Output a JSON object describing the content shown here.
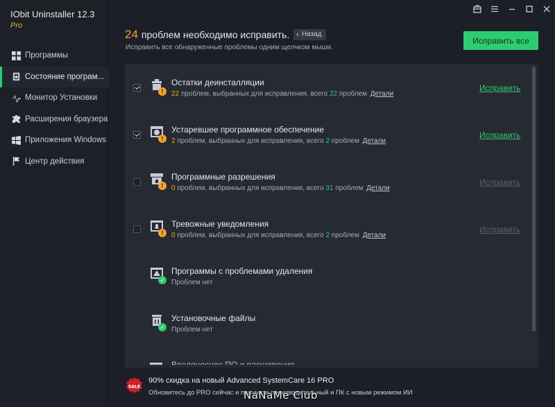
{
  "app": {
    "title": "IObit Uninstaller 12.3",
    "edition": "Pro"
  },
  "sidebar": {
    "items": [
      {
        "label": "Программы",
        "icon": "grid-icon",
        "active": false
      },
      {
        "label": "Состояние програм...",
        "icon": "health-icon",
        "active": true
      },
      {
        "label": "Монитор Установки",
        "icon": "monitor-icon",
        "active": false
      },
      {
        "label": "Расширения браузера",
        "icon": "puzzle-icon",
        "active": false
      },
      {
        "label": "Приложения Windows",
        "icon": "windows-icon",
        "active": false
      },
      {
        "label": "Центр действия",
        "icon": "flag-icon",
        "active": false
      }
    ]
  },
  "window_controls": [
    "toolbox-icon",
    "menu-icon",
    "minimize-icon",
    "maximize-icon",
    "close-icon"
  ],
  "header": {
    "count": "24",
    "title": "проблем необходимо исправить.",
    "back_label": "Назад",
    "subtitle": "Исправить все обнаруженные проблемы одним щелчком мыши.",
    "fix_all_label": "Исправить все"
  },
  "colors": {
    "accent": "#2ecc71",
    "warning": "#f0a52c",
    "background": "#1c1f27",
    "panel": "#262a33"
  },
  "issues": [
    {
      "title": "Остатки деинсталляции",
      "selected": "22",
      "stats_mid": "проблем, выбранных для исправления, всего",
      "total": "22",
      "stats_end": "проблем",
      "details": "Детали",
      "fix": "Исправить",
      "checked": true,
      "status": "warning",
      "icon": "eraser-icon"
    },
    {
      "title": "Устаревшее программное обеспечение",
      "selected": "2",
      "stats_mid": "проблем, выбранных для исправления, всего",
      "total": "2",
      "stats_end": "проблем",
      "details": "Детали",
      "fix": "Исправить",
      "checked": true,
      "status": "warning",
      "icon": "outdated-software-icon"
    },
    {
      "title": "Программные разрешения",
      "selected": "0",
      "stats_mid": "проблем, выбранных для исправления, всего",
      "total": "31",
      "stats_end": "проблем",
      "details": "Детали",
      "fix": "Исправить",
      "checked": false,
      "status": "warning",
      "icon": "lock-icon"
    },
    {
      "title": "Тревожные уведомления",
      "selected": "0",
      "stats_mid": "проблем, выбранных для исправления, всего",
      "total": "2",
      "stats_end": "проблем",
      "details": "Детали",
      "fix": "Исправить",
      "checked": false,
      "status": "warning",
      "icon": "bell-icon"
    },
    {
      "title": "Программы с проблемами удаления",
      "none_label": "Проблем нет",
      "checked": false,
      "status": "ok",
      "icon": "alert-window-icon"
    },
    {
      "title": "Установочные файлы",
      "none_label": "Проблем нет",
      "checked": false,
      "status": "ok",
      "icon": "trash-icon"
    }
  ],
  "partial_row_title": "Вредоносное ПО и расширения",
  "promo": {
    "badge": "SALE",
    "title": "90% скидка на новый Advanced SystemCare 16 PRO",
    "subtitle": "Обновитесь до PRO сейчас и получите производительный и ПК с новым режимом ИИ"
  },
  "watermark": "NaNaMe Club"
}
